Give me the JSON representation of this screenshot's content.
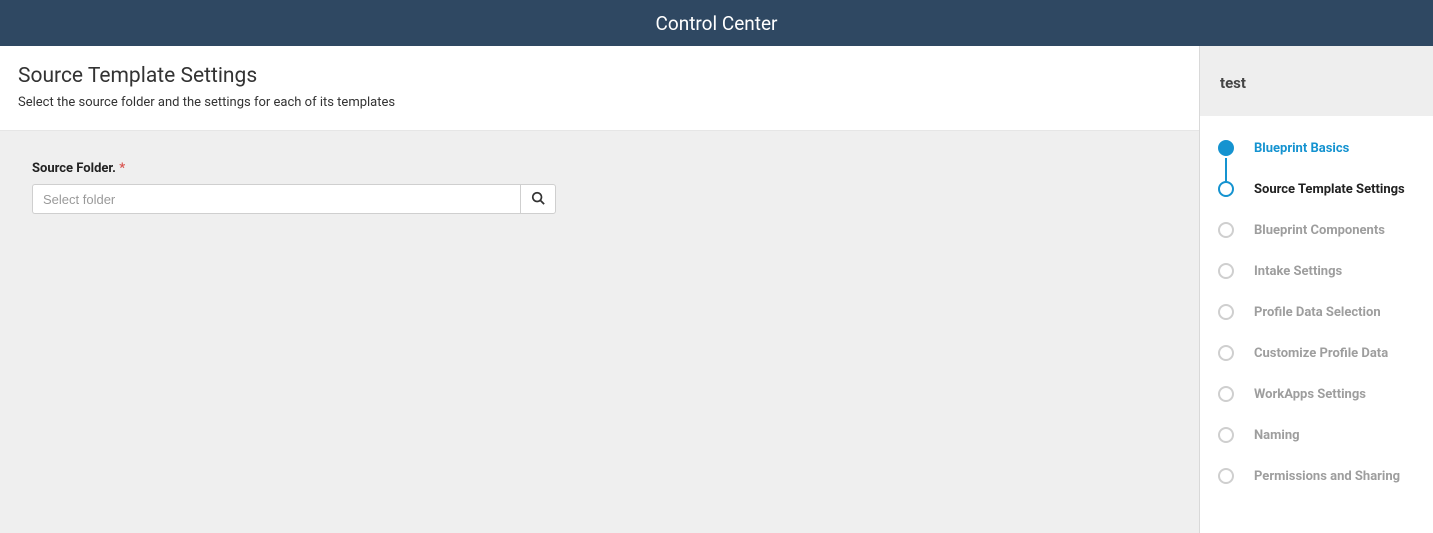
{
  "banner": {
    "title": "Control Center"
  },
  "page": {
    "title": "Source Template Settings",
    "subtitle": "Select the source folder and the settings for each of its templates"
  },
  "source_field": {
    "label": "Source Folder.",
    "required_mark": "*",
    "placeholder": "Select folder",
    "value": ""
  },
  "side": {
    "title": "test",
    "steps": [
      {
        "label": "Blueprint Basics",
        "state": "done"
      },
      {
        "label": "Source Template Settings",
        "state": "current"
      },
      {
        "label": "Blueprint Components",
        "state": "future"
      },
      {
        "label": "Intake Settings",
        "state": "future"
      },
      {
        "label": "Profile Data Selection",
        "state": "future"
      },
      {
        "label": "Customize Profile Data",
        "state": "future"
      },
      {
        "label": "WorkApps Settings",
        "state": "future"
      },
      {
        "label": "Naming",
        "state": "future"
      },
      {
        "label": "Permissions and Sharing",
        "state": "future"
      }
    ]
  }
}
